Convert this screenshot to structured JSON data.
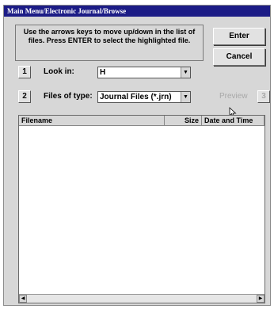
{
  "window": {
    "title": "Main Menu/Electronic Journal/Browse"
  },
  "instructions": "Use the arrows keys to move up/down in the list of files. Press ENTER to select the highlighted file.",
  "buttons": {
    "enter": "Enter",
    "cancel": "Cancel"
  },
  "look_in": {
    "number": "1",
    "label": "Look in:",
    "value": "H"
  },
  "files_of_type": {
    "number": "2",
    "label": "Files of type:",
    "value": "Journal Files (*.jrn)"
  },
  "preview": {
    "label": "Preview",
    "number": "3"
  },
  "file_list": {
    "columns": [
      "Filename",
      "Size",
      "Date and Time"
    ],
    "rows": []
  },
  "icons": [
    "dropdown-arrow-icon",
    "scroll-left-icon",
    "scroll-right-icon",
    "mouse-cursor-icon"
  ]
}
